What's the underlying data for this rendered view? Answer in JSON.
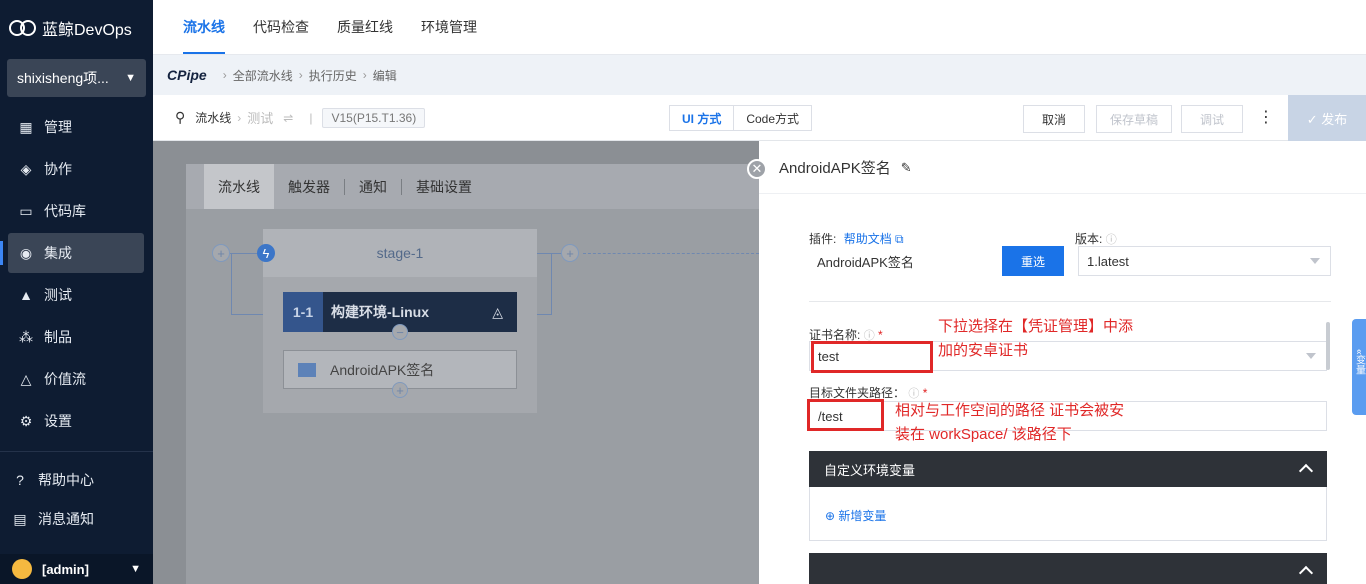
{
  "brand": {
    "name": "蓝鲸DevOps"
  },
  "project": {
    "name": "shixisheng项..."
  },
  "sidebar": {
    "items": [
      {
        "label": "管理",
        "icon": "grid-icon"
      },
      {
        "label": "协作",
        "icon": "collaborate-icon"
      },
      {
        "label": "代码库",
        "icon": "code-icon"
      },
      {
        "label": "集成",
        "icon": "integration-icon"
      },
      {
        "label": "测试",
        "icon": "flask-icon"
      },
      {
        "label": "制品",
        "icon": "artifact-icon"
      },
      {
        "label": "价值流",
        "icon": "value-stream-icon"
      },
      {
        "label": "设置",
        "icon": "gear-icon"
      }
    ],
    "help": "帮助中心",
    "notice": "消息通知",
    "user": "[admin]"
  },
  "topnav": {
    "tabs": [
      "流水线",
      "代码检查",
      "质量红线",
      "环境管理"
    ]
  },
  "breadcrumb": {
    "logo": "CPipe",
    "items": [
      "全部流水线",
      "执行历史",
      "编辑"
    ]
  },
  "toolbar": {
    "pipeline_label": "流水线",
    "pipeline_name": "测试",
    "version": "V15(P15.T1.36)",
    "mode_ui": "UI 方式",
    "mode_code": "Code方式",
    "cancel": "取消",
    "save_draft": "保存草稿",
    "debug": "调试",
    "publish": "✓ 发布"
  },
  "canvas": {
    "tabs": [
      "流水线",
      "触发器",
      "通知",
      "基础设置"
    ],
    "stage_title": "stage-1",
    "job_num": "1-1",
    "job_label": "构建环境-Linux",
    "step_label": "AndroidAPK签名"
  },
  "panel": {
    "title": "AndroidAPK签名",
    "plugin_label": "插件:",
    "help_doc": "帮助文档",
    "plugin_value": "AndroidAPK签名",
    "reselect": "重选",
    "version_label": "版本:",
    "version_value": "1.latest",
    "cert_label": "证书名称:",
    "cert_value": "test",
    "target_label": "目标文件夹路径：",
    "target_value": "/test",
    "note1_line1": "下拉选择在【凭证管理】中添",
    "note1_line2": "加的安卓证书",
    "note2_line1": "相对与工作空间的路径 证书会被安",
    "note2_line2": "装在 workSpace/ 该路径下",
    "env_section": "自定义环境变量",
    "add_var": "⊕ 新增变量",
    "side_tab": "«变量"
  },
  "colors": {
    "accent": "#1a73e8",
    "sidebar_bg": "#0e1c32",
    "annotation_red": "#e02828"
  }
}
